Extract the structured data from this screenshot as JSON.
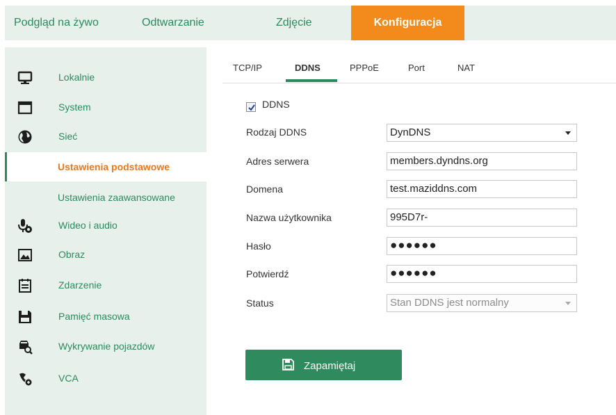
{
  "nav": {
    "live": "Podgląd na żywo",
    "playback": "Odtwarzanie",
    "picture": "Zdjęcie",
    "config": "Konfiguracja"
  },
  "sidebar": {
    "items": [
      {
        "label": "Lokalnie",
        "icon": "monitor-icon"
      },
      {
        "label": "System",
        "icon": "window-icon"
      },
      {
        "label": "Sieć",
        "icon": "globe-icon"
      },
      {
        "label": "Wideo i audio",
        "icon": "microphone-icon"
      },
      {
        "label": "Obraz",
        "icon": "image-icon"
      },
      {
        "label": "Zdarzenie",
        "icon": "calendar-icon"
      },
      {
        "label": "Pamięć masowa",
        "icon": "floppy-icon"
      },
      {
        "label": "Wykrywanie pojazdów",
        "icon": "vehicle-search-icon"
      },
      {
        "label": "VCA",
        "icon": "vca-icon"
      }
    ],
    "sub": {
      "basic": "Ustawienia podstawowe",
      "advanced": "Ustawienia zaawansowane"
    }
  },
  "tabs": [
    "TCP/IP",
    "DDNS",
    "PPPoE",
    "Port",
    "NAT"
  ],
  "active_tab": "DDNS",
  "form": {
    "ddns_checkbox_label": "DDNS",
    "ddns_enabled": true,
    "labels": {
      "type": "Rodzaj DDNS",
      "server": "Adres serwera",
      "domain": "Domena",
      "user": "Nazwa użytkownika",
      "password": "Hasło",
      "confirm": "Potwierdź",
      "status": "Status"
    },
    "values": {
      "type": "DynDNS",
      "server": "members.dyndns.org",
      "domain": "test.maziddns.com",
      "user": "995D7r-",
      "password": "●●●●●●",
      "confirm": "●●●●●●",
      "status": "Stan DDNS jest normalny"
    },
    "save": "Zapamiętaj"
  },
  "colors": {
    "accent_green": "#2a8a5b",
    "active_orange": "#f28a1c",
    "sidebar_bg": "#e8f0ec",
    "button_green": "#2f8a5e"
  }
}
